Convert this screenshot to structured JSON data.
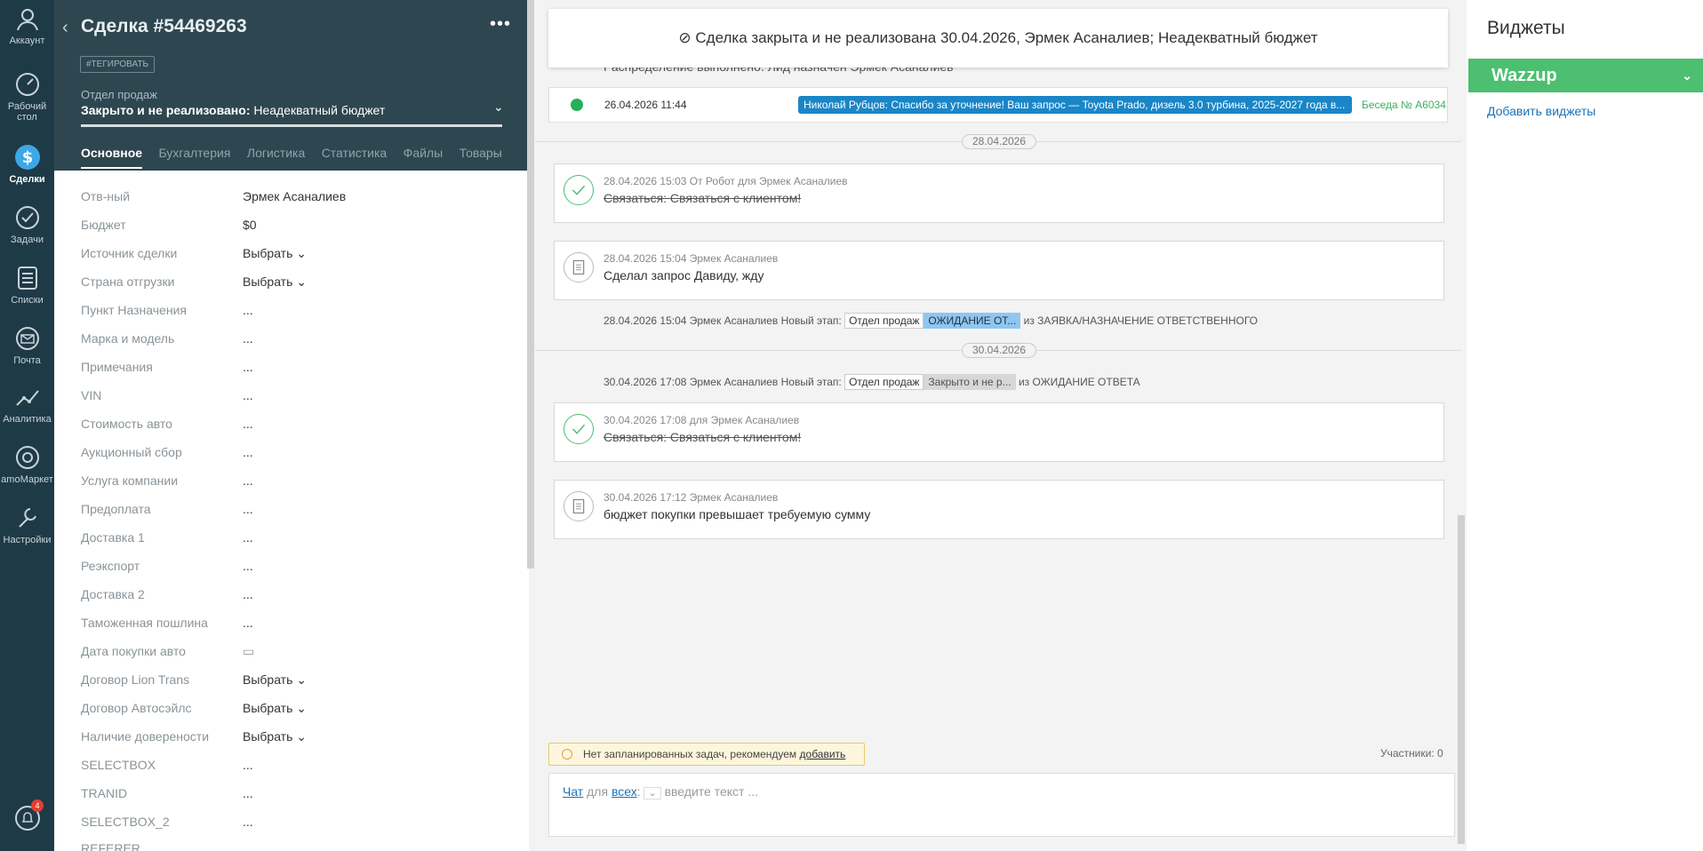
{
  "nav": {
    "account": "Аккаунт",
    "desktop": "Рабочий стол",
    "deals": "Сделки",
    "tasks": "Задачи",
    "lists": "Списки",
    "mail": "Почта",
    "analytics": "Аналитика",
    "market": "amoМаркет",
    "settings": "Настройки",
    "notifications_count": "4"
  },
  "deal": {
    "title": "Сделка #54469263",
    "tag": "#ТЕГИРОВАТЬ",
    "pipeline": "Отдел продаж",
    "stage_prefix": "Закрыто и не реализовано:",
    "stage_reason": "Неадекватный бюджет",
    "tabs": [
      "Основное",
      "Бухгалтерия",
      "Логистика",
      "Статистика",
      "Файлы",
      "Товары"
    ],
    "fields": [
      {
        "label": "Отв-ный",
        "value": "Эрмек Асаналиев"
      },
      {
        "label": "Бюджет",
        "value": "$0"
      },
      {
        "label": "Источник сделки",
        "value": "Выбрать ⌄"
      },
      {
        "label": "Страна отгрузки",
        "value": "Выбрать ⌄"
      },
      {
        "label": "Пункт Назначения",
        "value": "..."
      },
      {
        "label": "Марка и модель",
        "value": "..."
      },
      {
        "label": "Примечания",
        "value": "..."
      },
      {
        "label": "VIN",
        "value": "..."
      },
      {
        "label": "Стоимость авто",
        "value": "..."
      },
      {
        "label": "Аукционный сбор",
        "value": "..."
      },
      {
        "label": "Услуга компании",
        "value": "..."
      },
      {
        "label": "Предоплата",
        "value": "..."
      },
      {
        "label": "Доставка 1",
        "value": "..."
      },
      {
        "label": "Реэкспорт",
        "value": "..."
      },
      {
        "label": "Доставка 2",
        "value": "..."
      },
      {
        "label": "Таможенная пошлина",
        "value": "..."
      },
      {
        "label": "Дата покупки авто",
        "value": "▭"
      },
      {
        "label": "Договор Lion Trans",
        "value": "Выбрать ⌄"
      },
      {
        "label": "Договор Автосэйлс",
        "value": "Выбрать ⌄"
      },
      {
        "label": "Наличие доверености",
        "value": "Выбрать ⌄"
      },
      {
        "label": "SELECTBOX",
        "value": "..."
      },
      {
        "label": "TRANID",
        "value": "..."
      },
      {
        "label": "SELECTBOX_2",
        "value": "..."
      },
      {
        "label": "REFERER",
        "value": ""
      }
    ]
  },
  "feed": {
    "banner": "⊘ Сделка закрыта и не реализована 30.04.2026, Эрмек Асаналиев; Неадекватный бюджет",
    "dist_text": "Распределение выполнено. Лид назначен Эрмек Асаналиев",
    "chat": {
      "time": "26.04.2026 11:44",
      "message": "Николай Рубцов: Спасибо за уточнение! Ваш запрос — Toyota Prado, дизель 3.0 турбина, 2025-2027 года в...",
      "conversation": "Беседа № A6034"
    },
    "date1": "28.04.2026",
    "card1": {
      "meta": "28.04.2026 15:03  От Робот для Эрмек Асаналиев",
      "text": "Связаться: Связаться с клиентом!"
    },
    "card2": {
      "meta": "28.04.2026 15:04 Эрмек Асаналиев",
      "text": "Сделал запрос Давиду, жду"
    },
    "stage1": {
      "prefix": "28.04.2026 15:04 Эрмек Асаналиев Новый этап:",
      "pipe": "Отдел продаж",
      "stage": "ОЖИДАНИЕ ОТ...",
      "from": "из ЗАЯВКА/НАЗНАЧЕНИЕ ОТВЕТСТВЕННОГО"
    },
    "date2": "30.04.2026",
    "stage2": {
      "prefix": "30.04.2026 17:08 Эрмек Асаналиев Новый этап:",
      "pipe": "Отдел продаж",
      "stage": "Закрыто и не р...",
      "from": "из ОЖИДАНИЕ ОТВЕТА"
    },
    "card3": {
      "meta": "30.04.2026 17:08  для Эрмек Асаналиев",
      "text": "Связаться: Связаться с клиентом!"
    },
    "card4": {
      "meta": "30.04.2026 17:12 Эрмек Асаналиев",
      "text": "бюджет покупки превышает требуемую сумму"
    },
    "notask_text": "Нет запланированных задач, рекомендуем",
    "notask_link": "добавить",
    "members": "Участники: 0",
    "composer": {
      "chat": "Чат",
      "for": "для",
      "all": "всех",
      "placeholder": "введите текст ..."
    }
  },
  "widgets": {
    "title": "Виджеты",
    "wazzup": "Wazzup",
    "add": "Добавить виджеты"
  }
}
